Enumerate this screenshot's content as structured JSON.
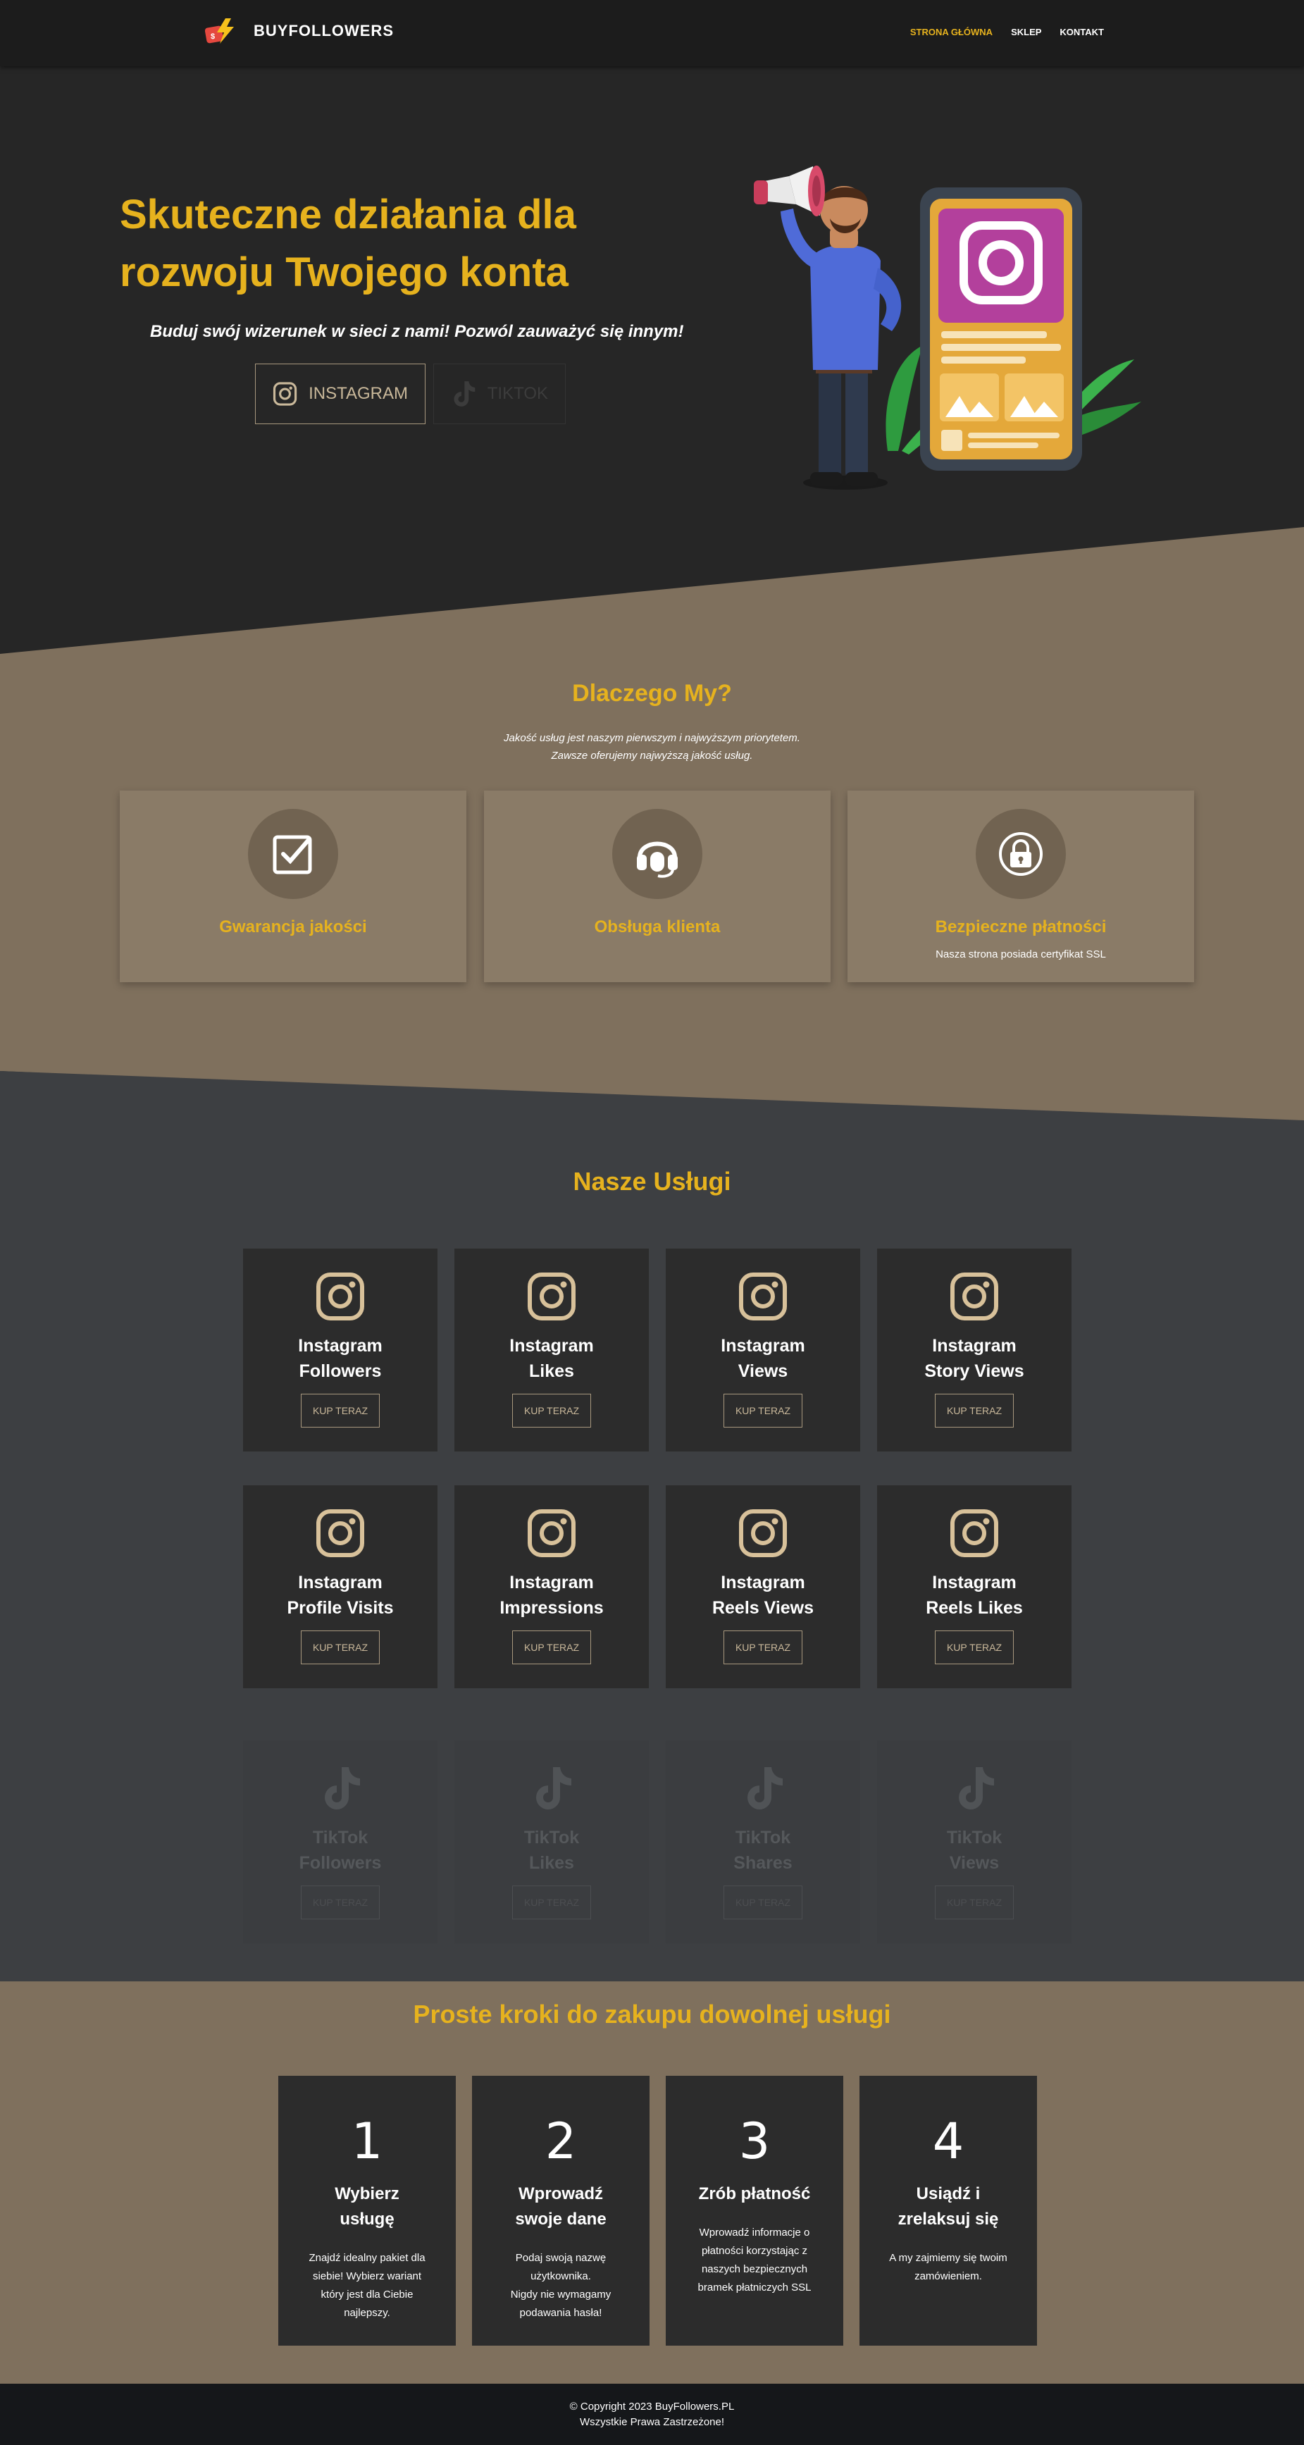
{
  "nav": {
    "brand": "BUYFOLLOWERS",
    "items": [
      {
        "label": "STRONA GŁÓWNA",
        "active": true
      },
      {
        "label": "SKLEP",
        "active": false
      },
      {
        "label": "KONTAKT",
        "active": false
      }
    ]
  },
  "hero": {
    "title": "Skuteczne działania dla rozwoju Twojego konta",
    "subtitle": "Buduj swój wizerunek w sieci z nami! Pozwól zauważyć się innym!",
    "platforms": [
      {
        "label": "INSTAGRAM",
        "icon": "instagram-icon",
        "active": true
      },
      {
        "label": "TIKTOK",
        "icon": "tiktok-icon",
        "active": false
      }
    ]
  },
  "why": {
    "title": "Dlaczego My?",
    "subtitle_line1": "Jakość usług jest naszym pierwszym i najwyższym priorytetem.",
    "subtitle_line2": "Zawsze oferujemy najwyższą jakość usług.",
    "cards": [
      {
        "label": "Gwarancja jakości",
        "icon": "checkbox-icon",
        "desc": ""
      },
      {
        "label": "Obsługa klienta",
        "icon": "headset-icon",
        "desc": ""
      },
      {
        "label": "Bezpieczne płatności",
        "icon": "lock-icon",
        "desc": "Nasza strona posiada certyfikat SSL"
      }
    ]
  },
  "services": {
    "title": "Nasze Usługi",
    "buy_label": "KUP TERAZ",
    "instagram": [
      {
        "line1": "Instagram",
        "line2": "Followers"
      },
      {
        "line1": "Instagram",
        "line2": "Likes"
      },
      {
        "line1": "Instagram",
        "line2": "Views"
      },
      {
        "line1": "Instagram",
        "line2": "Story Views"
      },
      {
        "line1": "Instagram",
        "line2": "Profile Visits"
      },
      {
        "line1": "Instagram",
        "line2": "Impressions"
      },
      {
        "line1": "Instagram",
        "line2": "Reels Views"
      },
      {
        "line1": "Instagram",
        "line2": "Reels Likes"
      }
    ],
    "tiktok": [
      {
        "line1": "TikTok",
        "line2": "Followers"
      },
      {
        "line1": "TikTok",
        "line2": "Likes"
      },
      {
        "line1": "TikTok",
        "line2": "Shares"
      },
      {
        "line1": "TikTok",
        "line2": "Views"
      }
    ]
  },
  "steps": {
    "title": "Proste kroki do zakupu dowolnej usługi",
    "items": [
      {
        "num": "1",
        "h1": "Wybierz",
        "h2": "usługę",
        "text": [
          "Znajdź idealny pakiet dla",
          "siebie! Wybierz wariant",
          "który jest dla Ciebie",
          "najlepszy."
        ]
      },
      {
        "num": "2",
        "h1": "Wprowadź",
        "h2": "swoje dane",
        "text": [
          "Podaj swoją nazwę",
          "użytkownika.",
          "Nigdy nie wymagamy",
          "podawania hasła!"
        ]
      },
      {
        "num": "3",
        "h1": "Zrób płatność",
        "h2": "",
        "text": [
          "Wprowadź informacje o",
          "płatności korzystając z",
          "naszych bezpiecznych",
          "bramek płatniczych SSL"
        ]
      },
      {
        "num": "4",
        "h1": "Usiądź i",
        "h2": "zrelaksuj się",
        "text": [
          "A my zajmiemy się twoim",
          "zamówieniem."
        ]
      }
    ]
  },
  "footer": {
    "line1": "© Copyright 2023 BuyFollowers.PL",
    "line2": "Wszystkie Prawa Zastrzeżone!"
  },
  "colors": {
    "accent": "#e6b21e",
    "tan": "#7f705d",
    "dark": "#262626",
    "slate": "#3d3f42"
  }
}
